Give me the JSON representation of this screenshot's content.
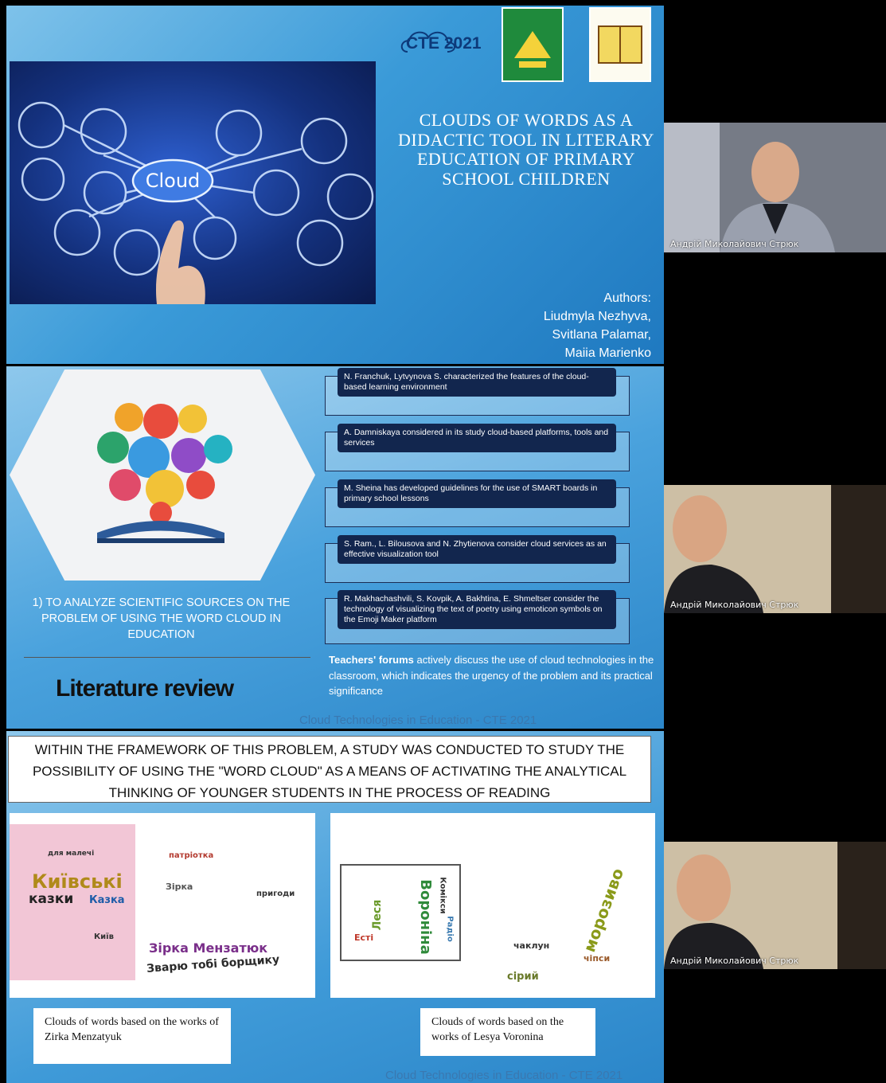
{
  "slide1": {
    "logo_text": "CTE 2021",
    "title": "CLOUDS OF WORDS AS A DIDACTIC TOOL IN LITERARY EDUCATION OF PRIMARY SCHOOL CHILDREN",
    "image_label": "Cloud",
    "authors_label": "Authors:",
    "authors": [
      "Liudmyla Nezhyva,",
      "Svitlana Palamar,",
      "Maiia Marienko"
    ]
  },
  "slide2": {
    "references": [
      "N. Franchuk, Lytvynova S. characterized the features of the cloud-based learning environment",
      "A. Damniskaya considered in its study cloud-based platforms, tools and services",
      "M. Sheina has developed guidelines for the use of SMART boards in primary school lessons",
      "S. Ram., L. Bilousova and N. Zhytienova consider cloud services as an effective visualization tool",
      "R. Makhachashvili, S. Kovpik, A. Bakhtina, E. Shmeltser consider the technology of visualizing the text of poetry using emoticon symbols on the Emoji Maker platform"
    ],
    "objective": "1) TO ANALYZE SCIENTIFIC SOURCES ON THE PROBLEM OF USING THE WORD CLOUD IN EDUCATION",
    "section_title": "Literature review",
    "forums_bold": "Teachers' forums",
    "forums_text": " actively discuss the use of cloud technologies in the classroom, which indicates the urgency of the problem and its practical significance",
    "footer": "Cloud Technologies in Education - CTE 2021"
  },
  "slide3": {
    "heading": "WITHIN THE FRAMEWORK OF THIS PROBLEM, A STUDY WAS CONDUCTED TO STUDY THE POSSIBILITY OF USING THE \"WORD CLOUD\" AS A MEANS OF ACTIVATING THE ANALYTICAL THINKING OF YOUNGER STUDENTS IN THE PROCESS OF READING",
    "caption_left": "Clouds of words based on the works of Zirka Menzatyuk",
    "caption_right": "Clouds of words based on the works of Lesya Voronina",
    "left_words": [
      "Київські",
      "казки",
      "Казка",
      "Зірка Мензатюк",
      "Зварю тобі борщику",
      "патріотка",
      "Зірка",
      "пригоди",
      "для малечі",
      "Київ"
    ],
    "right_words": [
      "Воронiна",
      "Леся",
      "Комiкси",
      "Радіо",
      "морозиво",
      "чiпси",
      "чаклун",
      "Есті",
      "сірий"
    ],
    "footer": "Cloud Technologies in Education - CTE 2021"
  },
  "participants": [
    {
      "name": "Андрій Миколайович Стрюк"
    },
    {
      "name": "Андрій Миколайович Стрюк"
    },
    {
      "name": "Андрій Миколайович Стрюк"
    }
  ]
}
